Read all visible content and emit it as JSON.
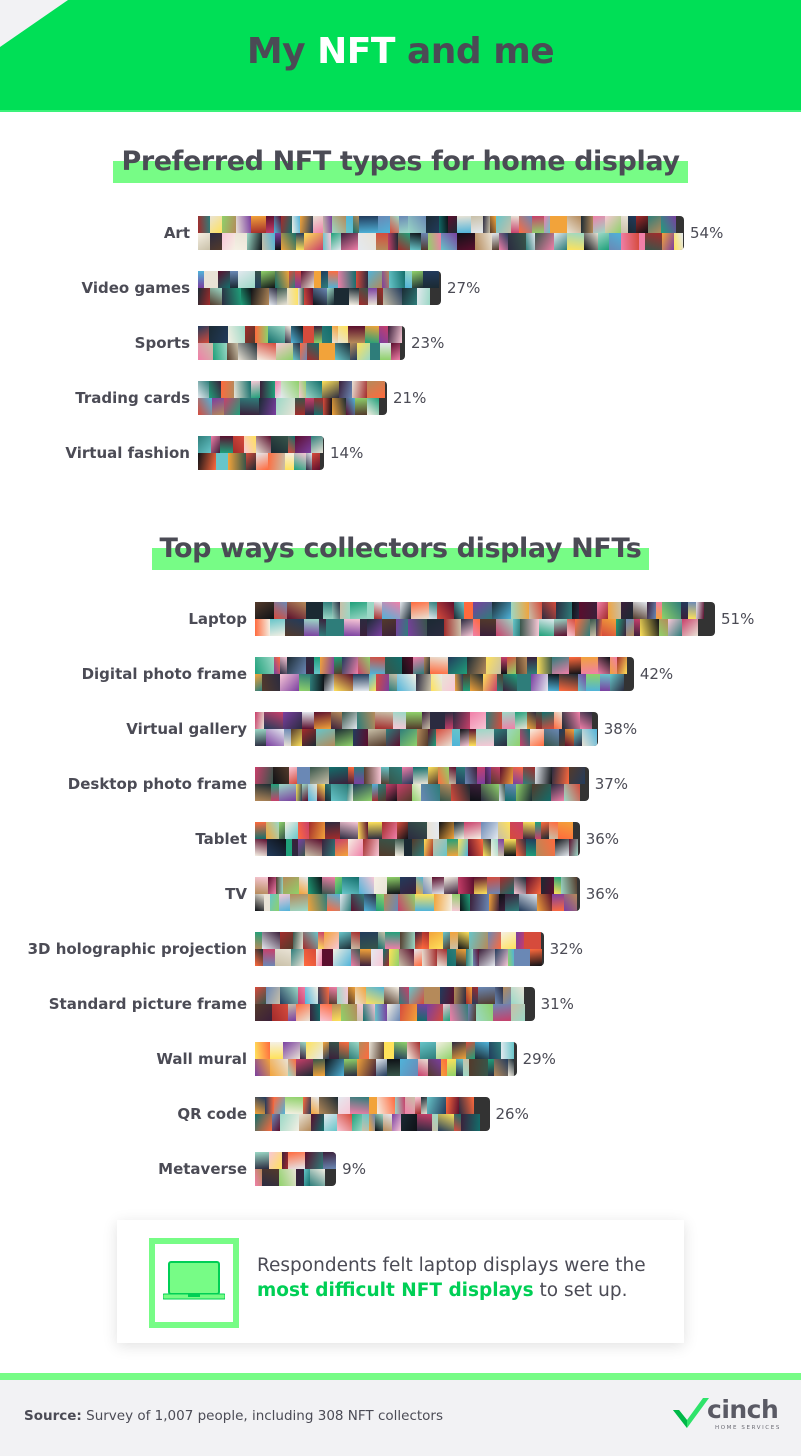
{
  "header": {
    "title_pre": "My ",
    "title_highlight": "NFT",
    "title_post": " and me"
  },
  "chart_data": [
    {
      "type": "bar",
      "orientation": "horizontal",
      "title": "Preferred NFT types for home display",
      "categories": [
        "Art",
        "Video games",
        "Sports",
        "Trading cards",
        "Virtual fashion"
      ],
      "values": [
        54,
        27,
        23,
        21,
        14
      ],
      "value_labels": [
        "54%",
        "27%",
        "23%",
        "21%",
        "14%"
      ],
      "unit": "%",
      "xlabel": "",
      "ylabel": "",
      "grid": false,
      "legend": "none",
      "bar_fill": "NFT image collage"
    },
    {
      "type": "bar",
      "orientation": "horizontal",
      "title": "Top ways collectors display NFTs",
      "categories": [
        "Laptop",
        "Digital photo frame",
        "Virtual gallery",
        "Desktop photo frame",
        "Tablet",
        "TV",
        "3D holographic projection",
        "Standard picture frame",
        "Wall mural",
        "QR code",
        "Metaverse"
      ],
      "values": [
        51,
        42,
        38,
        37,
        36,
        36,
        32,
        31,
        29,
        26,
        9
      ],
      "value_labels": [
        "51%",
        "42%",
        "38%",
        "37%",
        "36%",
        "36%",
        "32%",
        "31%",
        "29%",
        "26%",
        "9%"
      ],
      "unit": "%",
      "xlabel": "",
      "ylabel": "",
      "grid": false,
      "legend": "none",
      "bar_fill": "NFT image collage"
    }
  ],
  "callout": {
    "icon": "laptop-icon",
    "text_pre": "Respondents felt laptop displays were the ",
    "text_emphasis": "most difficult NFT displays",
    "text_post": " to set up."
  },
  "footer": {
    "source_label": "Source:",
    "source_text": " Survey of 1,007 people, including 308 NFT collectors",
    "logo_word": "cinch",
    "logo_sub": "HOME SERVICES"
  },
  "colors": {
    "brand_green": "#00df56",
    "highlight_green": "#77fc86",
    "text_dark": "#4b4b55",
    "footer_bg": "#f2f2f4"
  }
}
